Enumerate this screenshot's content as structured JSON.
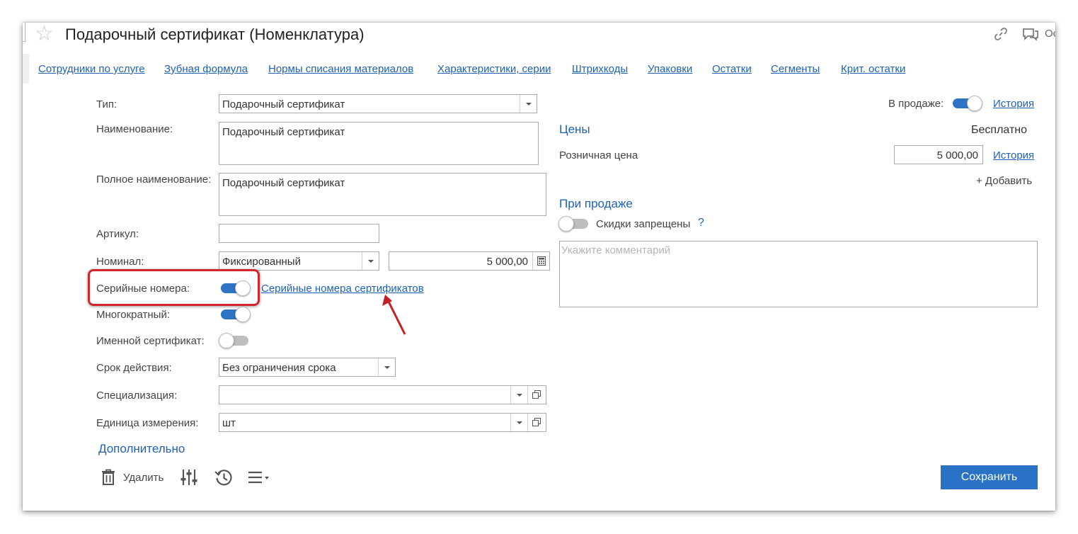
{
  "header": {
    "title": "Подарочный сертификат (Номенклатура)",
    "icons": [
      "star-icon",
      "link-icon",
      "comments-icon"
    ],
    "cut_text": "Ос"
  },
  "nav": {
    "links": [
      "Сотрудники по услуге",
      "Зубная формула",
      "Нормы списания материалов",
      "Характеристики, серии",
      "Штрихкоды",
      "Упаковки",
      "Остатки",
      "Сегменты",
      "Крит. остатки"
    ]
  },
  "form": {
    "type": {
      "label": "Тип:",
      "value": "Подарочный сертификат"
    },
    "name": {
      "label": "Наименование:",
      "value": "Подарочный сертификат"
    },
    "full_name": {
      "label": "Полное наименование:",
      "value": "Подарочный сертификат"
    },
    "article": {
      "label": "Артикул:",
      "value": ""
    },
    "nominal": {
      "label": "Номинал:",
      "mode": "Фиксированный",
      "amount": "5 000,00"
    },
    "serial_numbers": {
      "label": "Серийные номера:",
      "enabled": true,
      "link": "Серийные номера сертификатов"
    },
    "multiple": {
      "label": "Многократный:",
      "enabled": true
    },
    "named": {
      "label": "Именной сертификат:",
      "enabled": false
    },
    "validity": {
      "label": "Срок действия:",
      "value": "Без ограничения срока"
    },
    "specialization": {
      "label": "Специализация:",
      "value": ""
    },
    "unit": {
      "label": "Единица измерения:",
      "value": "шт"
    },
    "more": "Дополнительно"
  },
  "right": {
    "on_sale_label": "В продаже:",
    "on_sale": true,
    "history_link": "История",
    "prices_title": "Цены",
    "free_label": "Бесплатно",
    "retail_label": "Розничная цена",
    "retail_value": "5 000,00",
    "retail_history": "История",
    "add_label": "+ Добавить",
    "on_sale_section": "При продаже",
    "discounts_label": "Скидки запрещены",
    "discounts_forbidden": false,
    "help": "?",
    "comment_placeholder": "Укажите комментарий"
  },
  "toolbar": {
    "delete_label": "Удалить",
    "save_label": "Сохранить"
  },
  "colors": {
    "accent": "#2a72c6",
    "link": "#1e62b5",
    "highlight": "#d3262b"
  }
}
